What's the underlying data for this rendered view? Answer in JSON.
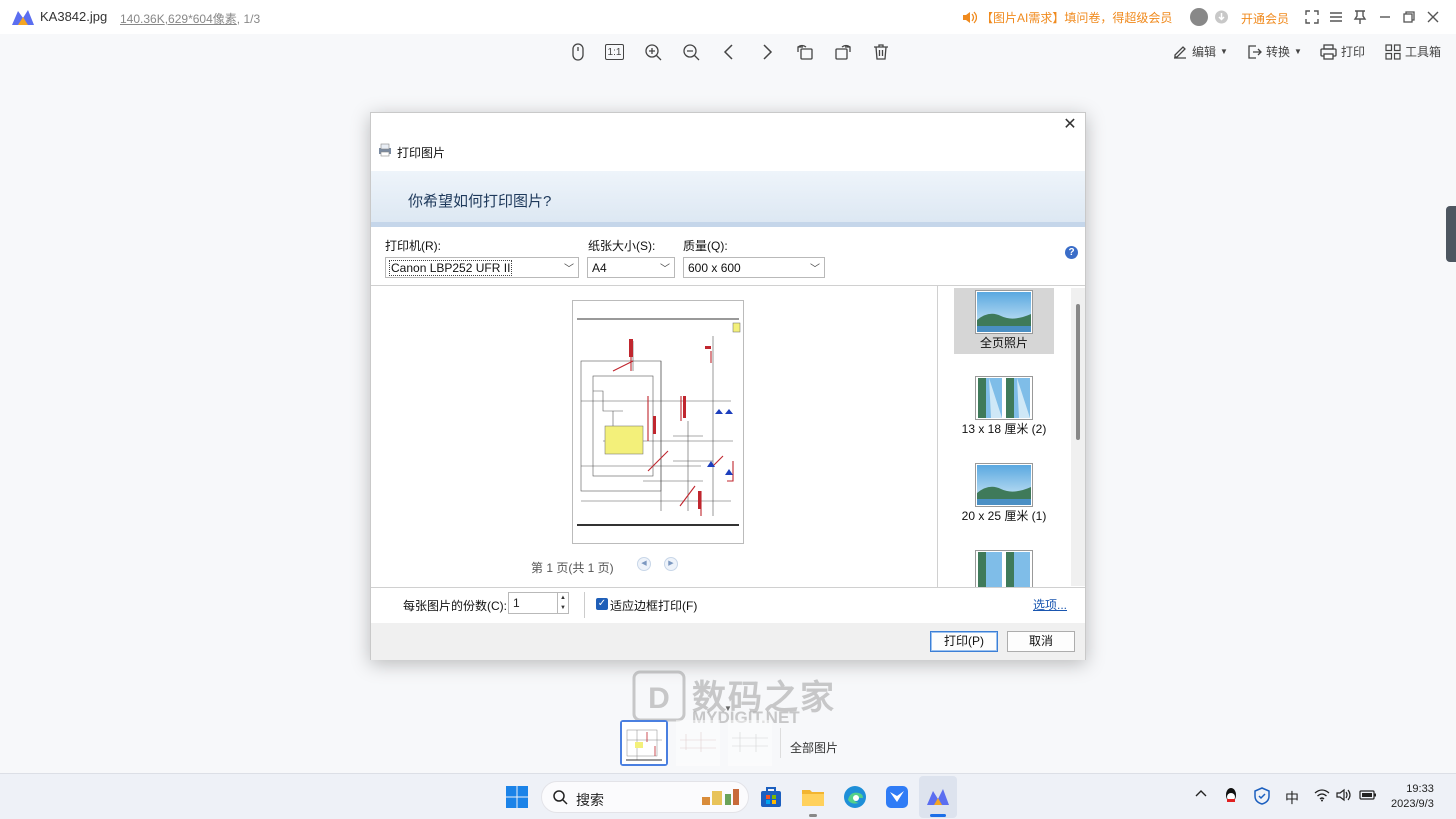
{
  "titlebar": {
    "file_name": "KA3842.jpg",
    "file_size": "140.36K",
    "dimensions": ",629*604像素",
    "index": ", 1/3",
    "promo_text": "【图片AI需求】填问卷，得超级会员",
    "vip_label": "开通会员",
    "brand_color": "#f08a1d"
  },
  "toolbar": {
    "one_to_one": "1:1",
    "edit_label": "编辑",
    "convert_label": "转换",
    "print_label": "打印",
    "toolbox_label": "工具箱"
  },
  "dialog": {
    "title": "打印图片",
    "banner": "你希望如何打印图片?",
    "printer_label": "打印机(R):",
    "printer_value": "Canon LBP252 UFR II",
    "paper_label": "纸张大小(S):",
    "paper_value": "A4",
    "quality_label": "质量(Q):",
    "quality_value": "600 x 600",
    "help": "?",
    "page_indicator": "第 1 页(共 1 页)",
    "layouts": [
      {
        "label": "全页照片"
      },
      {
        "label": "13 x 18 厘米 (2)"
      },
      {
        "label": "20 x 25 厘米 (1)"
      }
    ],
    "copies_label": "每张图片的份数(C):",
    "copies_value": "1",
    "fit_label": "适应边框打印(F)",
    "options_link": "选项...",
    "print_button": "打印(P)",
    "cancel_button": "取消"
  },
  "thumbnails": {
    "all_label": "全部图片"
  },
  "watermark": {
    "main": "数码之家",
    "sub": "MYDIGIT.NET"
  },
  "taskbar": {
    "search_placeholder": "搜索",
    "ime": "中",
    "time": "19:33",
    "date": "2023/9/3"
  }
}
